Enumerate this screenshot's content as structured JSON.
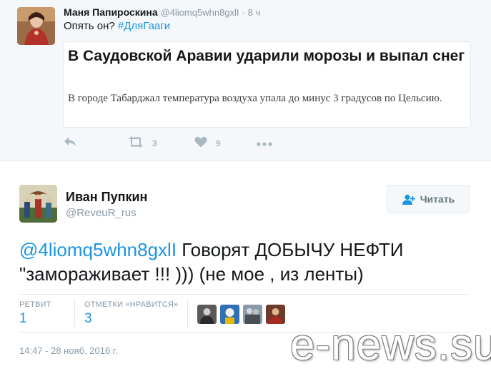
{
  "parent_tweet": {
    "fullname": "Маня Папироскина",
    "username": "@4liomq5whn8gxlI",
    "separator": "·",
    "time": "8 ч",
    "text_prefix": "Опять он? ",
    "hashtag": "#ДляГааги",
    "card": {
      "title": "В Саудовской Аравии ударили морозы и выпал снег",
      "description": "В городе Табарджал температура воздуха упала до минус 3 градусов по Цельсию."
    },
    "actions": {
      "retweet_count": "3",
      "like_count": "9"
    }
  },
  "main_tweet": {
    "fullname": "Иван Пупкин",
    "username": "@ReveuR_rus",
    "follow_label": "Читать",
    "mention": "@4liomq5whn8gxlI",
    "text": " Говорят ДОБЫЧУ НЕФТИ \"замораживает !!! ))) (не мое , из ленты)",
    "stats": {
      "retweets_label": "РЕТВИТ",
      "retweets_value": "1",
      "likes_label": "ОТМЕТКИ «НРАВИТСЯ»",
      "likes_value": "3"
    },
    "timestamp": "14:47 - 28 нояб. 2016 г."
  },
  "watermark": "e-news.su",
  "icons": [
    "reply-icon",
    "retweet-icon",
    "heart-icon",
    "more-icon",
    "follow-user-icon"
  ],
  "colors": {
    "link": "#1b95e0",
    "muted": "#8899a6",
    "action_gray": "#aab8c2",
    "parent_bg": "#f5f8fa",
    "border": "#e1e8ed"
  }
}
